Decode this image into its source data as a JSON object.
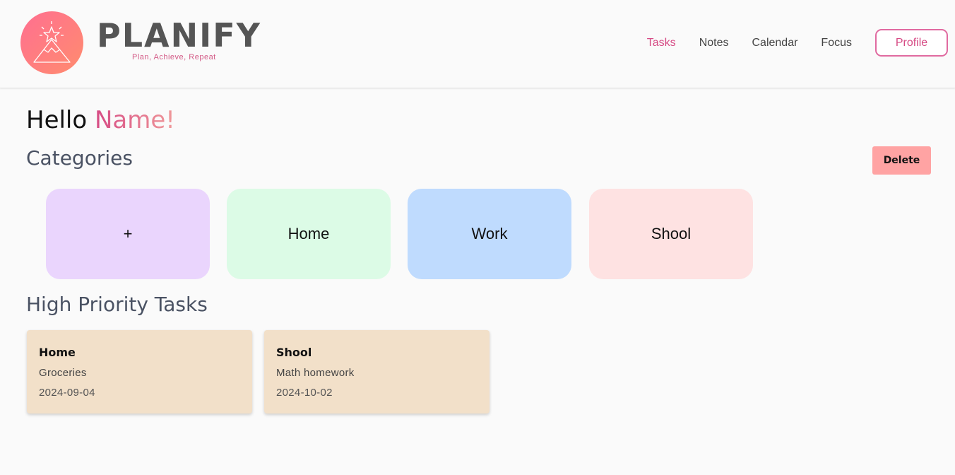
{
  "header": {
    "brand_name": "PLANIFY",
    "tagline": "Plan, Achieve, Repeat",
    "logo_icon": "mountain-star-icon",
    "nav": [
      {
        "label": "Tasks",
        "active": true
      },
      {
        "label": "Notes",
        "active": false
      },
      {
        "label": "Calendar",
        "active": false
      },
      {
        "label": "Focus",
        "active": false
      }
    ],
    "profile_label": "Profile"
  },
  "main": {
    "greeting_prefix": "Hello ",
    "greeting_name": "Name!",
    "categories_title": "Categories",
    "delete_label": "Delete",
    "categories": [
      {
        "label": "+",
        "color": "#ead5fd"
      },
      {
        "label": "Home",
        "color": "#dcfbe6"
      },
      {
        "label": "Work",
        "color": "#bfdbfe"
      },
      {
        "label": "Shool",
        "color": "#fee2e2"
      }
    ],
    "tasks_title": "High Priority Tasks",
    "tasks": [
      {
        "category": "Home",
        "description": "Groceries",
        "date": "2024-09-04"
      },
      {
        "category": "Shool",
        "description": "Math homework",
        "date": "2024-10-02"
      }
    ]
  },
  "colors": {
    "accent": "#d64a84",
    "delete_bg": "#ffa3a3",
    "task_card_bg": "#f2e0c9"
  }
}
